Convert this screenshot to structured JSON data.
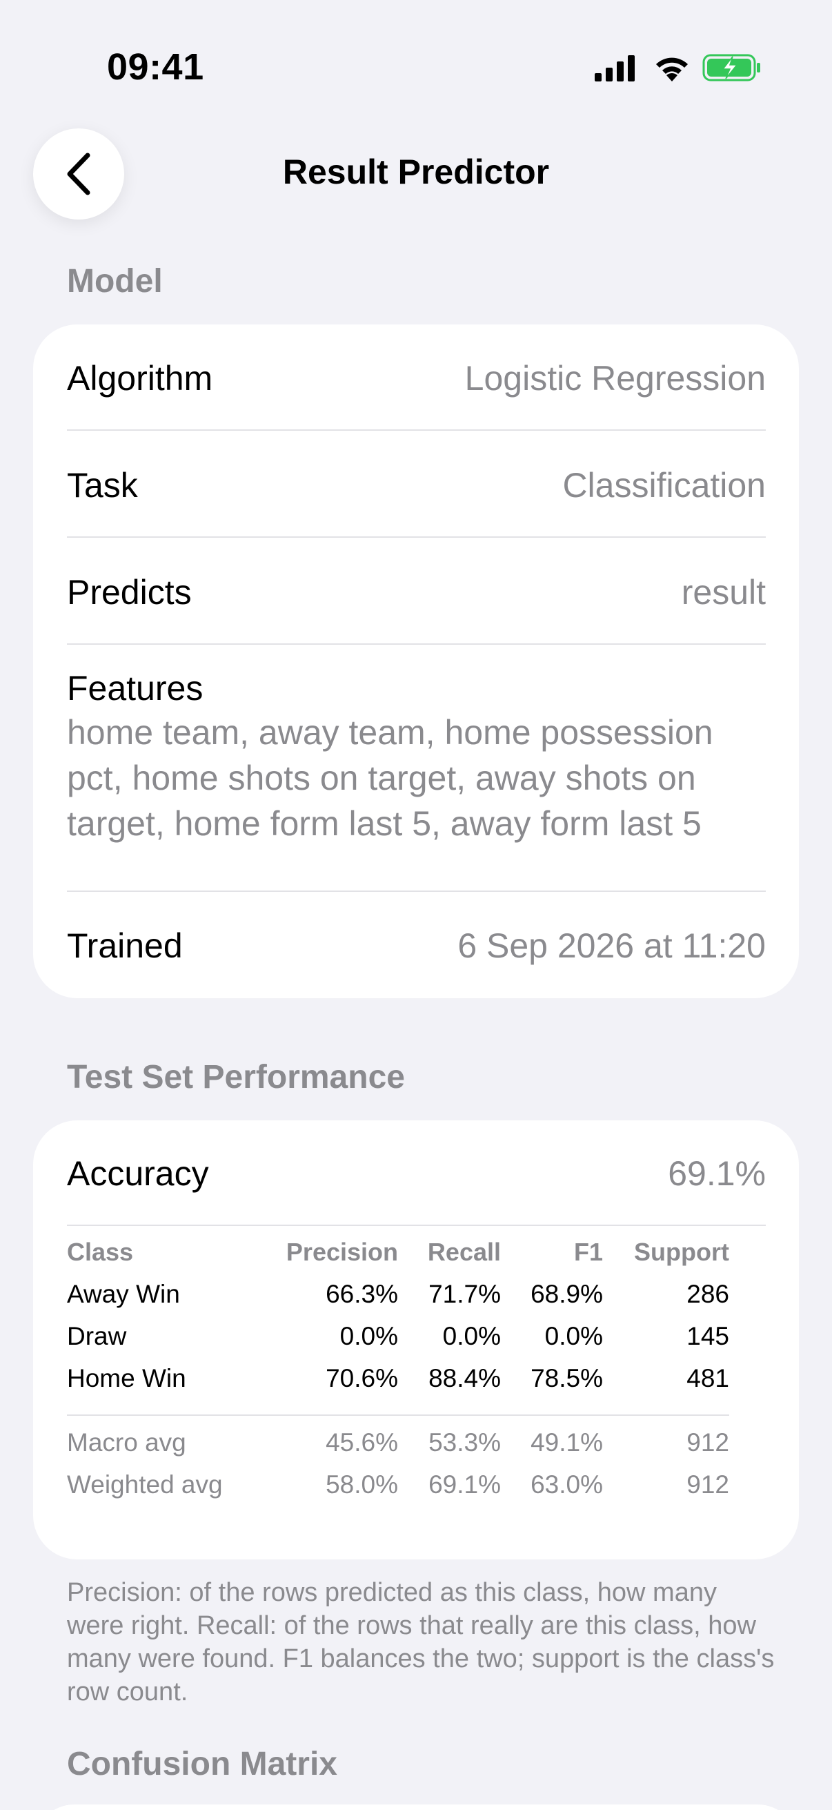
{
  "status": {
    "time": "09:41"
  },
  "nav": {
    "title": "Result Predictor"
  },
  "model_section": {
    "header": "Model",
    "algorithm_label": "Algorithm",
    "algorithm_value": "Logistic Regression",
    "task_label": "Task",
    "task_value": "Classification",
    "predicts_label": "Predicts",
    "predicts_value": "result",
    "features_label": "Features",
    "features_value": "home team, away team, home possession pct, home shots on target, away shots on target, home form last 5, away form last 5",
    "trained_label": "Trained",
    "trained_value": "6 Sep 2026 at 11:20"
  },
  "performance_section": {
    "header": "Test Set Performance",
    "accuracy_label": "Accuracy",
    "accuracy_value": "69.1%",
    "columns": [
      "Class",
      "Precision",
      "Recall",
      "F1",
      "Support"
    ],
    "rows": [
      [
        "Away Win",
        "66.3%",
        "71.7%",
        "68.9%",
        "286"
      ],
      [
        "Draw",
        "0.0%",
        "0.0%",
        "0.0%",
        "145"
      ],
      [
        "Home Win",
        "70.6%",
        "88.4%",
        "78.5%",
        "481"
      ]
    ],
    "averages": [
      [
        "Macro avg",
        "45.6%",
        "53.3%",
        "49.1%",
        "912"
      ],
      [
        "Weighted avg",
        "58.0%",
        "69.1%",
        "63.0%",
        "912"
      ]
    ],
    "footnote": "Precision: of the rows predicted as this class, how many were right. Recall: of the rows that really are this class, how many were found. F1 balances the two; support is the class's row count."
  },
  "confusion_section": {
    "header": "Confusion Matrix"
  },
  "colors": {
    "background": "#F2F2F7",
    "secondary_text": "#8A8A8E",
    "battery": "#34C759"
  }
}
